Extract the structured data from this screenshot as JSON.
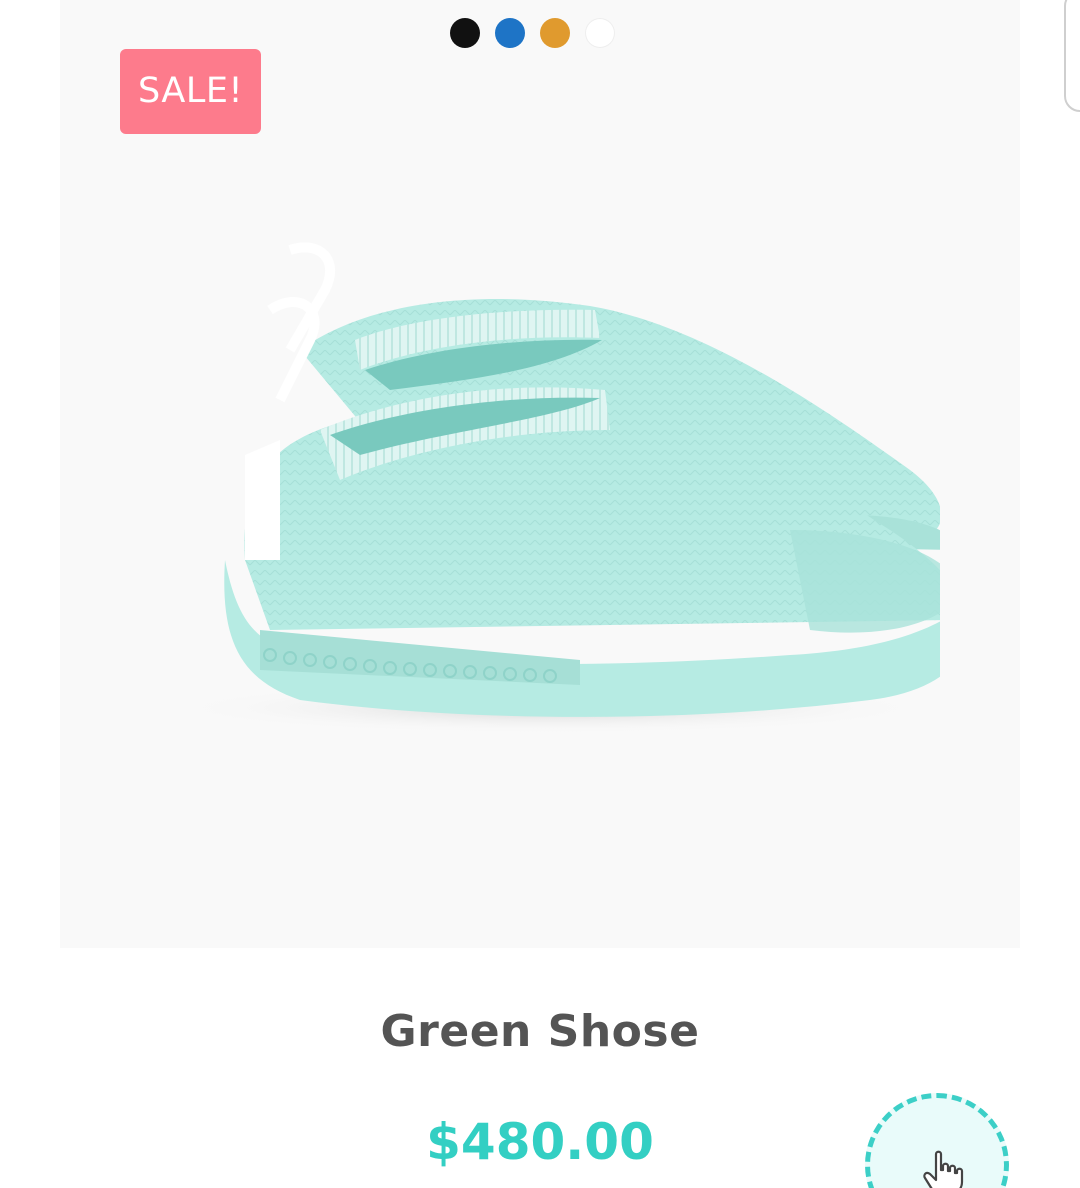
{
  "product": {
    "badge": "SALE!",
    "title": "Green Shose",
    "price": "$480.00",
    "image_icon": "sneaker-image",
    "swatches": [
      {
        "name": "black",
        "color": "#111111"
      },
      {
        "name": "blue",
        "color": "#1e74c6"
      },
      {
        "name": "orange",
        "color": "#e09a2e"
      },
      {
        "name": "white",
        "color": "#ffffff"
      }
    ]
  },
  "fab": {
    "icon": "pointer-hand-icon"
  },
  "colors": {
    "badge_bg": "#fd7b8c",
    "price": "#33cfc3",
    "title": "#545454",
    "shoe": "#b6ebe3",
    "accent": "#3ccfc7"
  }
}
